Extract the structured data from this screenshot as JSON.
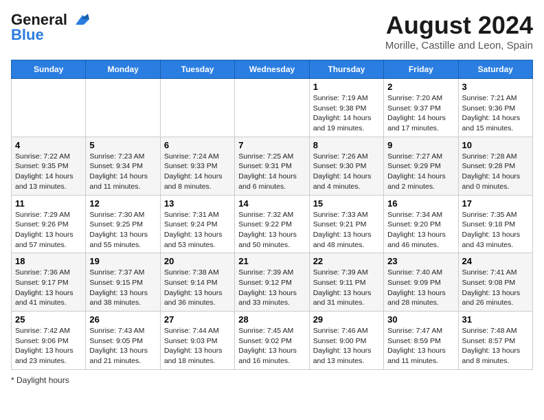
{
  "header": {
    "logo_line1": "General",
    "logo_line2": "Blue",
    "main_title": "August 2024",
    "subtitle": "Morille, Castille and Leon, Spain"
  },
  "days_of_week": [
    "Sunday",
    "Monday",
    "Tuesday",
    "Wednesday",
    "Thursday",
    "Friday",
    "Saturday"
  ],
  "footer": {
    "daylight_label": "Daylight hours"
  },
  "weeks": [
    [
      {
        "day": "",
        "detail": ""
      },
      {
        "day": "",
        "detail": ""
      },
      {
        "day": "",
        "detail": ""
      },
      {
        "day": "",
        "detail": ""
      },
      {
        "day": "1",
        "detail": "Sunrise: 7:19 AM\nSunset: 9:38 PM\nDaylight: 14 hours\nand 19 minutes."
      },
      {
        "day": "2",
        "detail": "Sunrise: 7:20 AM\nSunset: 9:37 PM\nDaylight: 14 hours\nand 17 minutes."
      },
      {
        "day": "3",
        "detail": "Sunrise: 7:21 AM\nSunset: 9:36 PM\nDaylight: 14 hours\nand 15 minutes."
      }
    ],
    [
      {
        "day": "4",
        "detail": "Sunrise: 7:22 AM\nSunset: 9:35 PM\nDaylight: 14 hours\nand 13 minutes."
      },
      {
        "day": "5",
        "detail": "Sunrise: 7:23 AM\nSunset: 9:34 PM\nDaylight: 14 hours\nand 11 minutes."
      },
      {
        "day": "6",
        "detail": "Sunrise: 7:24 AM\nSunset: 9:33 PM\nDaylight: 14 hours\nand 8 minutes."
      },
      {
        "day": "7",
        "detail": "Sunrise: 7:25 AM\nSunset: 9:31 PM\nDaylight: 14 hours\nand 6 minutes."
      },
      {
        "day": "8",
        "detail": "Sunrise: 7:26 AM\nSunset: 9:30 PM\nDaylight: 14 hours\nand 4 minutes."
      },
      {
        "day": "9",
        "detail": "Sunrise: 7:27 AM\nSunset: 9:29 PM\nDaylight: 14 hours\nand 2 minutes."
      },
      {
        "day": "10",
        "detail": "Sunrise: 7:28 AM\nSunset: 9:28 PM\nDaylight: 14 hours\nand 0 minutes."
      }
    ],
    [
      {
        "day": "11",
        "detail": "Sunrise: 7:29 AM\nSunset: 9:26 PM\nDaylight: 13 hours\nand 57 minutes."
      },
      {
        "day": "12",
        "detail": "Sunrise: 7:30 AM\nSunset: 9:25 PM\nDaylight: 13 hours\nand 55 minutes."
      },
      {
        "day": "13",
        "detail": "Sunrise: 7:31 AM\nSunset: 9:24 PM\nDaylight: 13 hours\nand 53 minutes."
      },
      {
        "day": "14",
        "detail": "Sunrise: 7:32 AM\nSunset: 9:22 PM\nDaylight: 13 hours\nand 50 minutes."
      },
      {
        "day": "15",
        "detail": "Sunrise: 7:33 AM\nSunset: 9:21 PM\nDaylight: 13 hours\nand 48 minutes."
      },
      {
        "day": "16",
        "detail": "Sunrise: 7:34 AM\nSunset: 9:20 PM\nDaylight: 13 hours\nand 46 minutes."
      },
      {
        "day": "17",
        "detail": "Sunrise: 7:35 AM\nSunset: 9:18 PM\nDaylight: 13 hours\nand 43 minutes."
      }
    ],
    [
      {
        "day": "18",
        "detail": "Sunrise: 7:36 AM\nSunset: 9:17 PM\nDaylight: 13 hours\nand 41 minutes."
      },
      {
        "day": "19",
        "detail": "Sunrise: 7:37 AM\nSunset: 9:15 PM\nDaylight: 13 hours\nand 38 minutes."
      },
      {
        "day": "20",
        "detail": "Sunrise: 7:38 AM\nSunset: 9:14 PM\nDaylight: 13 hours\nand 36 minutes."
      },
      {
        "day": "21",
        "detail": "Sunrise: 7:39 AM\nSunset: 9:12 PM\nDaylight: 13 hours\nand 33 minutes."
      },
      {
        "day": "22",
        "detail": "Sunrise: 7:39 AM\nSunset: 9:11 PM\nDaylight: 13 hours\nand 31 minutes."
      },
      {
        "day": "23",
        "detail": "Sunrise: 7:40 AM\nSunset: 9:09 PM\nDaylight: 13 hours\nand 28 minutes."
      },
      {
        "day": "24",
        "detail": "Sunrise: 7:41 AM\nSunset: 9:08 PM\nDaylight: 13 hours\nand 26 minutes."
      }
    ],
    [
      {
        "day": "25",
        "detail": "Sunrise: 7:42 AM\nSunset: 9:06 PM\nDaylight: 13 hours\nand 23 minutes."
      },
      {
        "day": "26",
        "detail": "Sunrise: 7:43 AM\nSunset: 9:05 PM\nDaylight: 13 hours\nand 21 minutes."
      },
      {
        "day": "27",
        "detail": "Sunrise: 7:44 AM\nSunset: 9:03 PM\nDaylight: 13 hours\nand 18 minutes."
      },
      {
        "day": "28",
        "detail": "Sunrise: 7:45 AM\nSunset: 9:02 PM\nDaylight: 13 hours\nand 16 minutes."
      },
      {
        "day": "29",
        "detail": "Sunrise: 7:46 AM\nSunset: 9:00 PM\nDaylight: 13 hours\nand 13 minutes."
      },
      {
        "day": "30",
        "detail": "Sunrise: 7:47 AM\nSunset: 8:59 PM\nDaylight: 13 hours\nand 11 minutes."
      },
      {
        "day": "31",
        "detail": "Sunrise: 7:48 AM\nSunset: 8:57 PM\nDaylight: 13 hours\nand 8 minutes."
      }
    ]
  ]
}
